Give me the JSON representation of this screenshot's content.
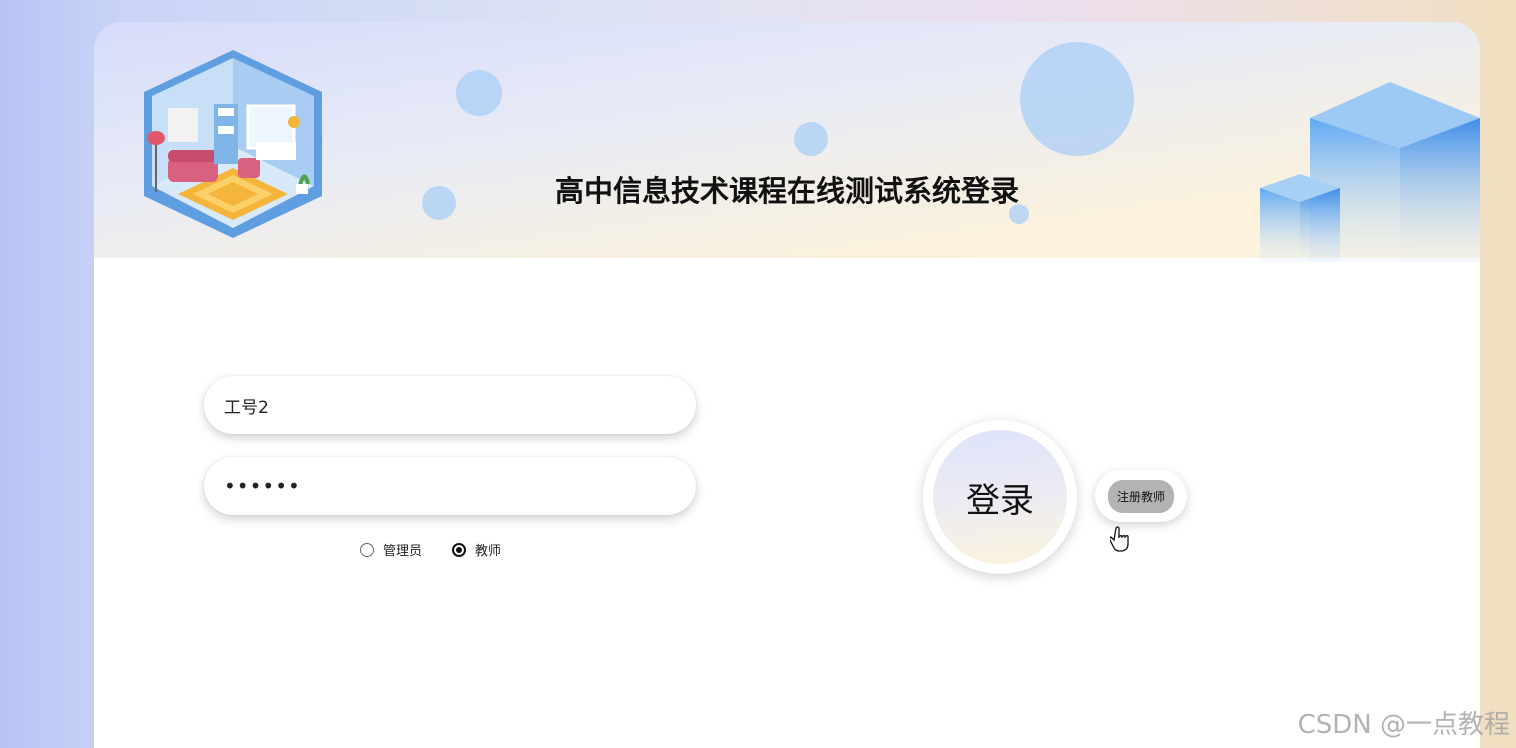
{
  "header": {
    "title": "高中信息技术课程在线测试系统登录"
  },
  "form": {
    "username_value": "工号2",
    "password_value": "••••••",
    "roles": [
      {
        "label": "管理员",
        "selected": false
      },
      {
        "label": "教师",
        "selected": true
      }
    ]
  },
  "actions": {
    "login_label": "登录",
    "register_label": "注册教师"
  },
  "watermark": "CSDN @一点教程",
  "icons": [
    "room-illustration-icon",
    "cubes-decoration-icon",
    "hand-cursor-icon"
  ]
}
